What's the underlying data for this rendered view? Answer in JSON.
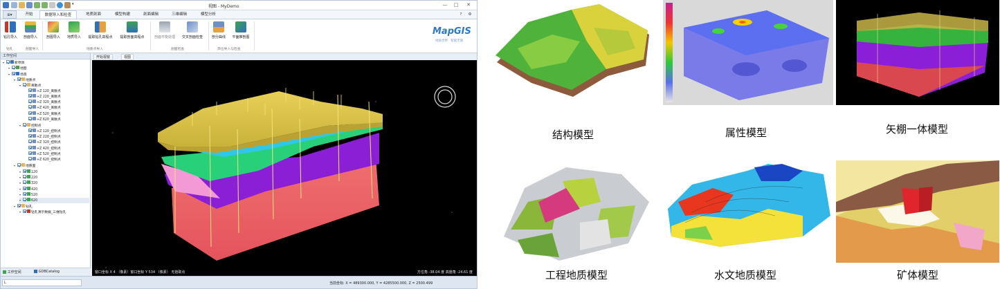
{
  "window": {
    "title": "视图 - MyDemo",
    "controls": [
      "—",
      "□",
      "✕"
    ],
    "header_icons": [
      "?",
      "⚙"
    ]
  },
  "ribbon": {
    "file_menu": "⊞▾",
    "tabs": [
      "开始",
      "数据导入和检查",
      "地质剖面",
      "模型构建",
      "剖面编辑",
      "三维编辑",
      "模型分析"
    ],
    "buttons": [
      {
        "label": "钻孔导入"
      },
      {
        "label": "剖面导入"
      },
      {
        "label": "剖图导入"
      },
      {
        "label": "地质导入"
      },
      {
        "label": "提取钻孔高程点"
      },
      {
        "label": "提取剖面高程点"
      },
      {
        "label": "剖面平衡处理"
      },
      {
        "label": "交叉剖面检查"
      },
      {
        "label": "剖分曲线"
      },
      {
        "label": "平面推剖图"
      }
    ],
    "groups": [
      "钻孔",
      "剖面导入",
      "地质点导入",
      "剖面检查",
      "异位导入与检查"
    ],
    "brand": "MapGIS",
    "brand_slogan": "地质世界 · 智能无限"
  },
  "workspace": {
    "title": "工作空间",
    "tree": [
      {
        "label": "新项目",
        "level": 0,
        "icon": "project-icon"
      },
      {
        "label": "地图",
        "level": 1,
        "icon": "map-icon"
      },
      {
        "label": "场景",
        "level": 1,
        "icon": "scene-icon"
      },
      {
        "label": "地质点",
        "level": 2,
        "icon": "folder-icon"
      },
      {
        "label": "离散点",
        "level": 3,
        "icon": "folder-icon"
      },
      {
        "label": "+Z 120_离散点",
        "level": 4,
        "icon": "point-layer-icon"
      },
      {
        "label": "+Z 220_离散点",
        "level": 4,
        "icon": "point-layer-icon"
      },
      {
        "label": "+Z 320_离散点",
        "level": 4,
        "icon": "point-layer-icon"
      },
      {
        "label": "+Z 420_离散点",
        "level": 4,
        "icon": "point-layer-icon"
      },
      {
        "label": "+Z 520_离散点",
        "level": 4,
        "icon": "point-layer-icon"
      },
      {
        "label": "+Z 620_离散点",
        "level": 4,
        "icon": "point-layer-icon"
      },
      {
        "label": "控制点",
        "level": 3,
        "icon": "folder-icon"
      },
      {
        "label": "+Z 120_控制点",
        "level": 4,
        "icon": "point-layer-icon"
      },
      {
        "label": "+Z 220_控制点",
        "level": 4,
        "icon": "point-layer-icon"
      },
      {
        "label": "+Z 320_控制点",
        "level": 4,
        "icon": "point-layer-icon"
      },
      {
        "label": "+Z 420_控制点",
        "level": 4,
        "icon": "point-layer-icon"
      },
      {
        "label": "+Z 520_控制点",
        "level": 4,
        "icon": "point-layer-icon"
      },
      {
        "label": "+Z 620_控制点",
        "level": 4,
        "icon": "point-layer-icon"
      },
      {
        "label": "地质面",
        "level": 2,
        "icon": "folder-icon"
      },
      {
        "label": "120",
        "level": 3,
        "icon": "surface-layer-icon"
      },
      {
        "label": "220",
        "level": 3,
        "icon": "surface-layer-icon"
      },
      {
        "label": "320",
        "level": 3,
        "icon": "surface-layer-icon"
      },
      {
        "label": "420",
        "level": 3,
        "icon": "surface-layer-icon"
      },
      {
        "label": "520",
        "level": 3,
        "icon": "surface-layer-icon"
      },
      {
        "label": "620",
        "level": 3,
        "icon": "surface-layer-icon"
      },
      {
        "label": "钻孔",
        "level": 2,
        "icon": "folder-icon"
      },
      {
        "label": "钻孔演示数据_三维钻孔",
        "level": 3,
        "icon": "drill-layer-icon"
      }
    ],
    "bottom_tabs": [
      "工作空间",
      "GDBCatalog"
    ]
  },
  "view": {
    "tabs": [
      "开始视窗",
      "视图"
    ],
    "coords_left": "窗口坐标 X 4    （像素）窗口坐标 Y 534 （像素）  无拾取点",
    "coords_right": "方位角 -38.04 度   高度角 -24.61 度"
  },
  "status": {
    "input": "L",
    "coords": "当前坐标: X = 489300.000, Y = 4285500.000, Z = 2500.499"
  },
  "gallery": [
    {
      "caption": "结构模型"
    },
    {
      "caption": "属性模型"
    },
    {
      "caption": "矢棚一体模型"
    },
    {
      "caption": "工程地质模型"
    },
    {
      "caption": "水文地质模型"
    },
    {
      "caption": "矿体模型"
    }
  ]
}
